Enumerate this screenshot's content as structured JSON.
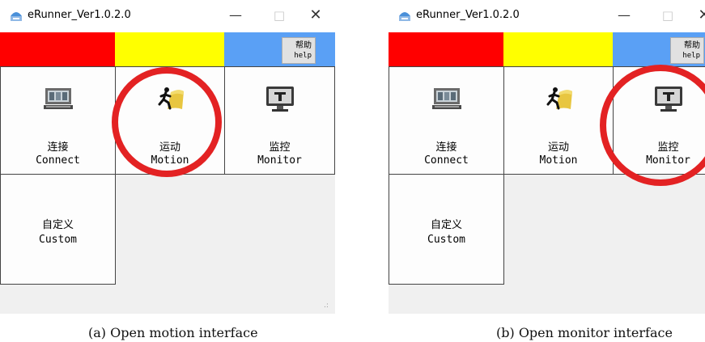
{
  "window": {
    "title": "eRunner_Ver1.0.2.0",
    "controls": {
      "minimize": "—",
      "maximize": "□",
      "close": "✕"
    }
  },
  "help_button": {
    "zh": "帮助",
    "en": "help"
  },
  "tiles": {
    "connect": {
      "zh": "连接",
      "en": "Connect",
      "icon": "computer-icon"
    },
    "motion": {
      "zh": "运动",
      "en": "Motion",
      "icon": "running-man-icon"
    },
    "monitor": {
      "zh": "监控",
      "en": "Monitor",
      "icon": "monitor-icon"
    },
    "custom": {
      "zh": "自定义",
      "en": "Custom"
    }
  },
  "status_colors": {
    "left": "#ff0000",
    "middle": "#ffff00",
    "right": "#5aa0f5"
  },
  "highlight_color": "#e32223",
  "resize_grip": ".:",
  "captions": {
    "a": "(a)  Open motion interface",
    "b": "(b)  Open monitor interface"
  }
}
